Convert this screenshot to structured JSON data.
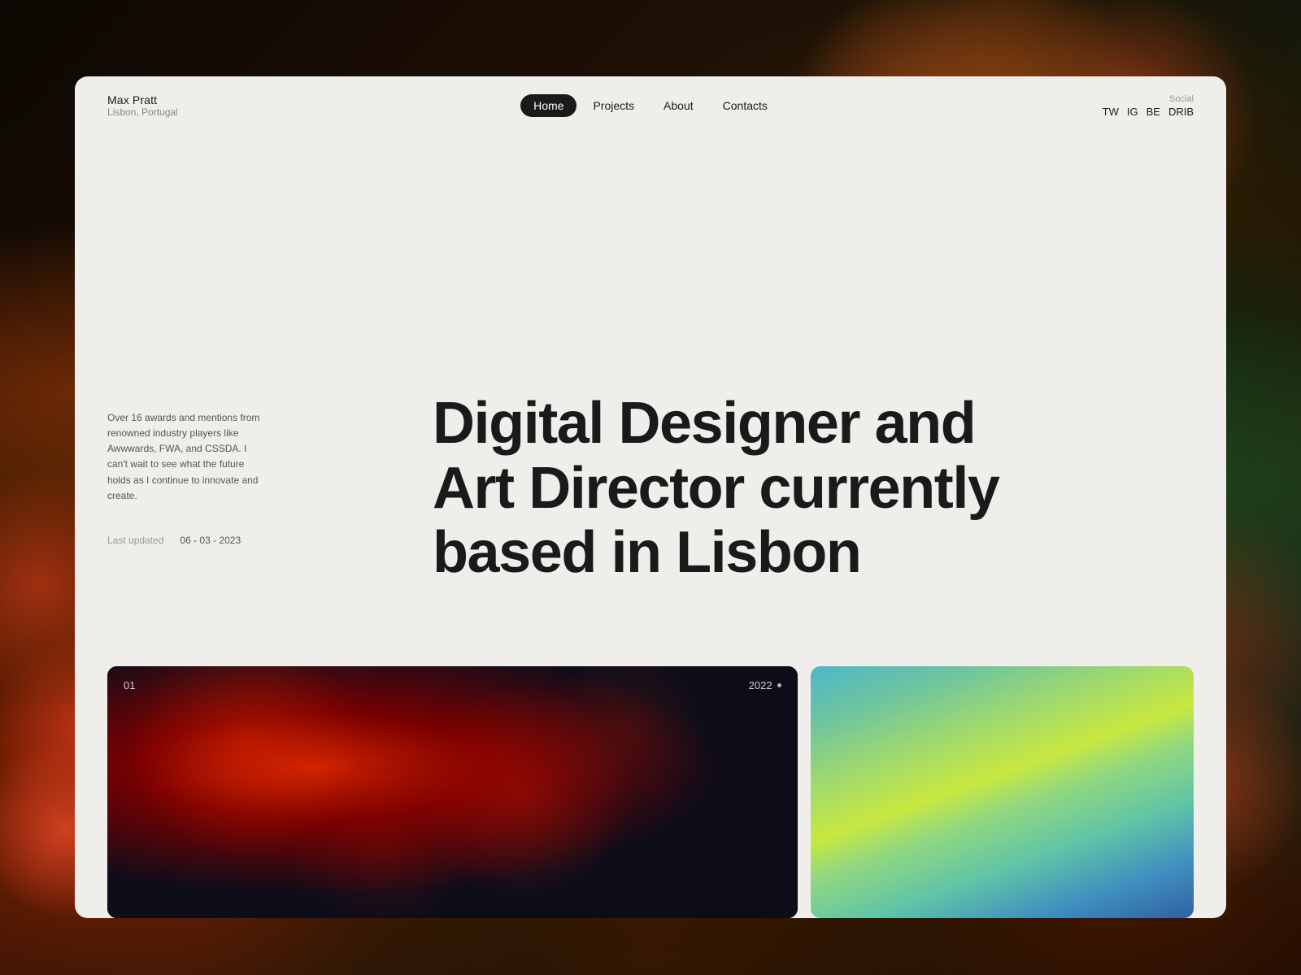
{
  "brand": {
    "name": "Max Pratt",
    "location": "Lisbon, Portugal"
  },
  "nav": {
    "links": [
      {
        "label": "Home",
        "active": true
      },
      {
        "label": "Projects",
        "active": false
      },
      {
        "label": "About",
        "active": false
      },
      {
        "label": "Contacts",
        "active": false
      }
    ],
    "social_label": "Social",
    "social_links": [
      {
        "label": "TW"
      },
      {
        "label": "IG"
      },
      {
        "label": "BE"
      },
      {
        "label": "DRIB"
      }
    ]
  },
  "hero": {
    "description": "Over 16 awards and mentions from renowned industry players like Awwwards, FWA, and CSSDA. I can't wait to see what the future holds as I continue to innovate and create.",
    "last_updated_label": "Last updated",
    "last_updated_date": "06 - 03 - 2023",
    "headline_line1": "Digital Designer and",
    "headline_line2": "Art Director currently",
    "headline_line3": "based in Lisbon"
  },
  "projects": [
    {
      "number": "01",
      "year": "2022"
    },
    {}
  ]
}
